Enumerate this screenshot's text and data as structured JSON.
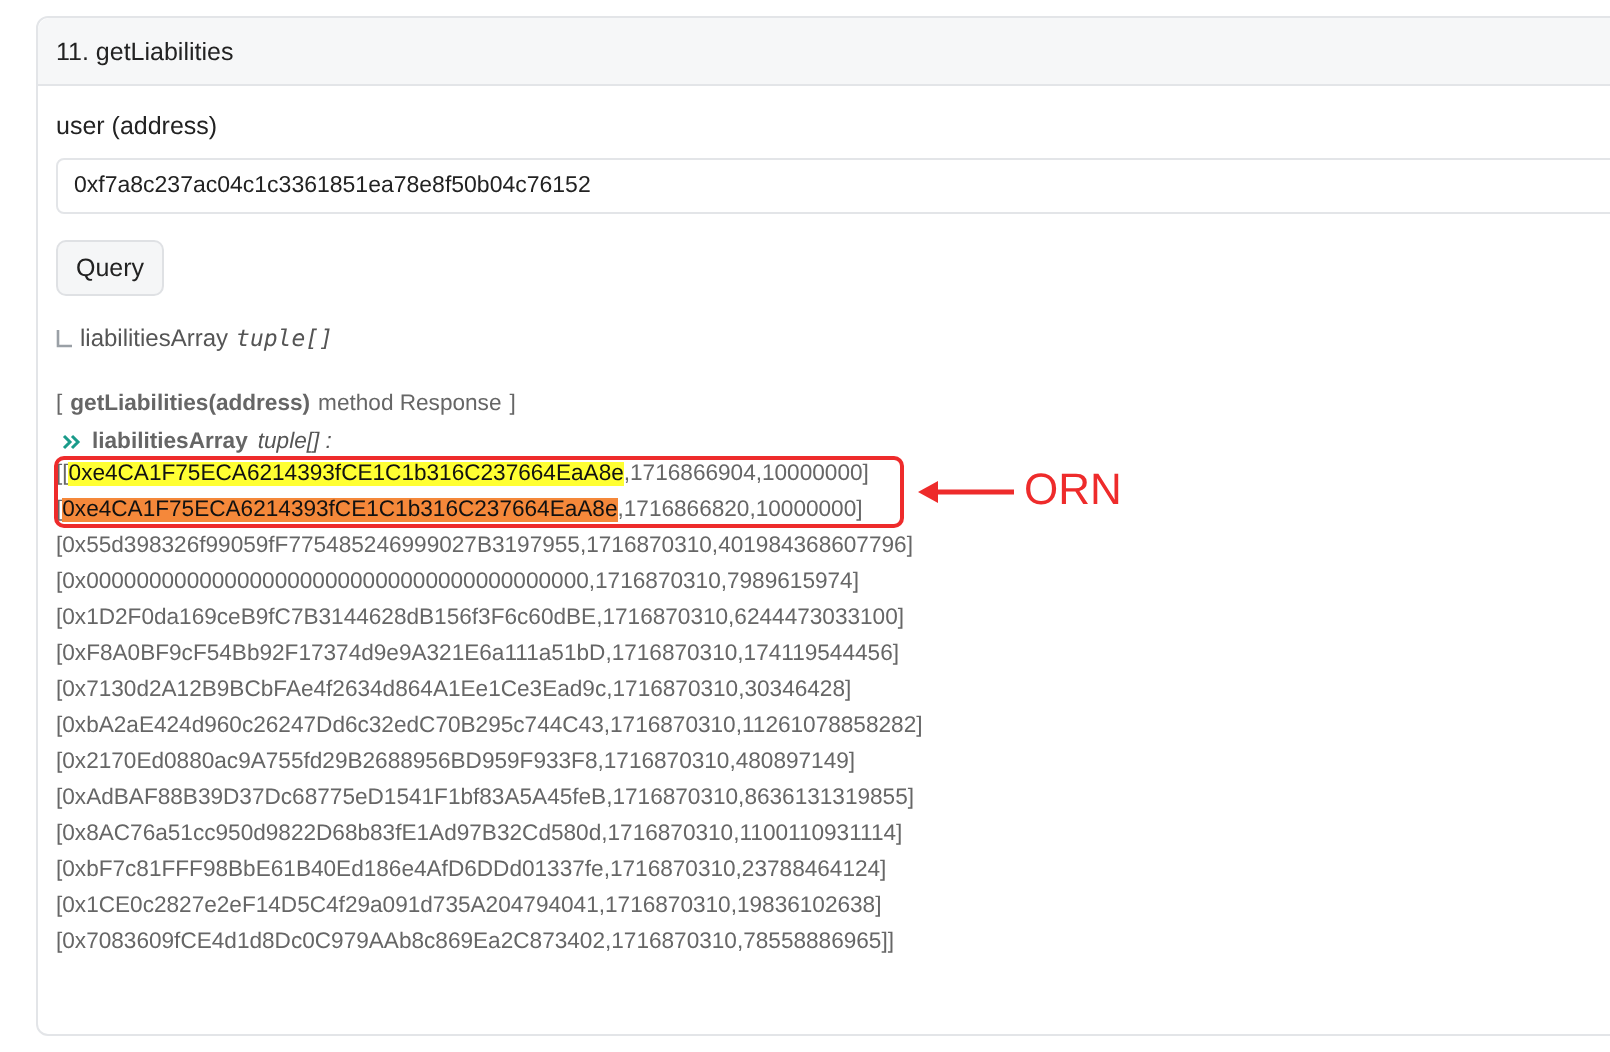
{
  "card": {
    "title": "11. getLiabilities"
  },
  "input": {
    "label": "user (address)",
    "value": "0xf7a8c237ac04c1c3361851ea78e8f50b04c76152"
  },
  "query_button": "Query",
  "output_hint": {
    "name": "liabilitiesArray",
    "type": "tuple[]"
  },
  "response": {
    "method": "getLiabilities(address)",
    "title_rest": "method Response",
    "open": "[",
    "close": "]",
    "field_name": "liabilitiesArray",
    "field_type": "tuple[] :",
    "rows": [
      {
        "before": "[[",
        "address": "0xe4CA1F75ECA6214393fCE1C1b316C237664EaA8e",
        "after": ",1716866904,10000000]",
        "color": "#ffff33"
      },
      {
        "before": "[",
        "address": "0xe4CA1F75ECA6214393fCE1C1b316C237664EaA8e",
        "after": ",1716866820,10000000]",
        "color": "#f5883a"
      },
      {
        "before": "[",
        "address": "0x55d398326f99059fF775485246999027B3197955",
        "after": ",1716870310,401984368607796]"
      },
      {
        "before": "[",
        "address": "0x0000000000000000000000000000000000000000",
        "after": ",1716870310,7989615974]"
      },
      {
        "before": "[",
        "address": "0x1D2F0da169ceB9fC7B3144628dB156f3F6c60dBE",
        "after": ",1716870310,6244473033100]"
      },
      {
        "before": "[",
        "address": "0xF8A0BF9cF54Bb92F17374d9e9A321E6a111a51bD",
        "after": ",1716870310,174119544456]"
      },
      {
        "before": "[",
        "address": "0x7130d2A12B9BCbFAe4f2634d864A1Ee1Ce3Ead9c",
        "after": ",1716870310,30346428]"
      },
      {
        "before": "[",
        "address": "0xbA2aE424d960c26247Dd6c32edC70B295c744C43",
        "after": ",1716870310,11261078858282]"
      },
      {
        "before": "[",
        "address": "0x2170Ed0880ac9A755fd29B2688956BD959F933F8",
        "after": ",1716870310,480897149]"
      },
      {
        "before": "[",
        "address": "0xAdBAF88B39D37Dc68775eD1541F1bf83A5A45feB",
        "after": ",1716870310,8636131319855]"
      },
      {
        "before": "[",
        "address": "0x8AC76a51cc950d9822D68b83fE1Ad97B32Cd580d",
        "after": ",1716870310,1100110931114]"
      },
      {
        "before": "[",
        "address": "0xbF7c81FFF98BbE61B40Ed186e4AfD6DDd01337fe",
        "after": ",1716870310,23788464124]"
      },
      {
        "before": "[",
        "address": "0x1CE0c2827e2eF14D5C4f29a091d735A204794041",
        "after": ",1716870310,19836102638]"
      },
      {
        "before": "[",
        "address": "0x7083609fCE4d1d8Dc0C979AAb8c869Ea2C873402",
        "after": ",1716870310,78558886965]]"
      }
    ]
  },
  "annotation": {
    "label": "ORN"
  }
}
